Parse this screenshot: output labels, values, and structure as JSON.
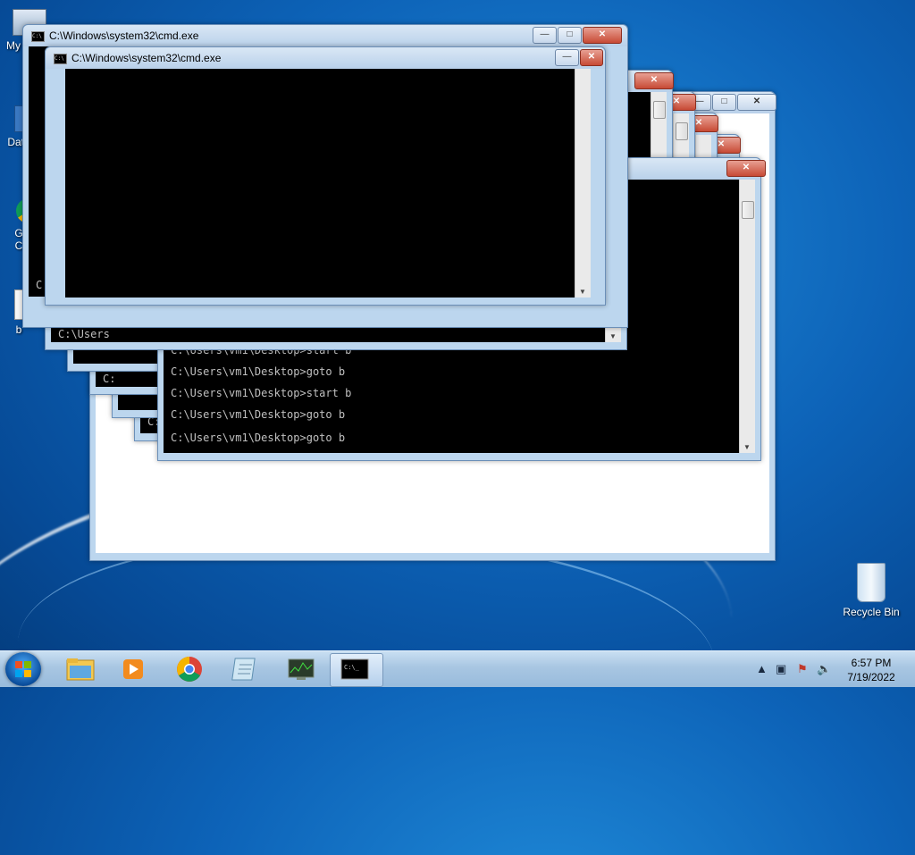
{
  "desktop": {
    "icons": [
      {
        "label": "My C"
      },
      {
        "label": "Data"
      },
      {
        "label": "G\nC"
      },
      {
        "label": "b"
      },
      {
        "label": "Recycle Bin"
      }
    ]
  },
  "windows": {
    "title": "C:\\Windows\\system32\\cmd.exe",
    "prompt_lines": {
      "c_users": "C:\\Users",
      "c_short": "C:",
      "start_b": "C:\\Users\\vm1\\Desktop>start b",
      "goto_b": "C:\\Users\\vm1\\Desktop>goto b"
    }
  },
  "taskbar": {
    "items": [
      {
        "name": "Windows Explorer"
      },
      {
        "name": "Windows Media Player"
      },
      {
        "name": "Google Chrome"
      },
      {
        "name": "Notepad"
      },
      {
        "name": "Task Manager"
      },
      {
        "name": "Command Prompt"
      }
    ],
    "clock": {
      "time": "6:57 PM",
      "date": "7/19/2022"
    }
  }
}
